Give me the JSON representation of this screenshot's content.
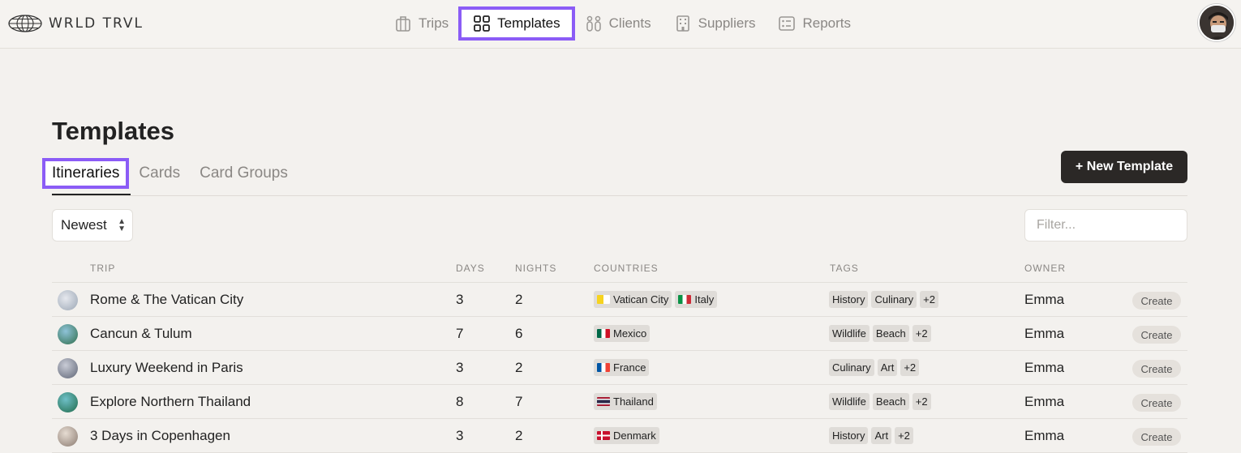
{
  "app": {
    "brand": "WRLD TRVL"
  },
  "nav": {
    "items": [
      {
        "label": "Trips",
        "icon": "suitcase-icon"
      },
      {
        "label": "Templates",
        "icon": "grid-icon",
        "active": true
      },
      {
        "label": "Clients",
        "icon": "people-icon"
      },
      {
        "label": "Suppliers",
        "icon": "building-icon"
      },
      {
        "label": "Reports",
        "icon": "report-icon"
      }
    ]
  },
  "page": {
    "title": "Templates",
    "tabs": [
      {
        "label": "Itineraries",
        "active": true
      },
      {
        "label": "Cards"
      },
      {
        "label": "Card Groups"
      }
    ],
    "new_button": "+ New Template",
    "sort": "Newest",
    "filter_placeholder": "Filter..."
  },
  "table": {
    "headers": {
      "trip": "TRIP",
      "days": "DAYS",
      "nights": "NIGHTS",
      "countries": "COUNTRIES",
      "tags": "TAGS",
      "owner": "OWNER"
    },
    "create_label": "Create",
    "rows": [
      {
        "trip": "Rome & The Vatican City",
        "days": "3",
        "nights": "2",
        "countries": [
          {
            "name": "Vatican City",
            "flag": "vatican"
          },
          {
            "name": "Italy",
            "flag": "italy"
          }
        ],
        "tags": [
          "History",
          "Culinary",
          "+2"
        ],
        "owner": "Emma",
        "thumb_color": "#b8c4d0"
      },
      {
        "trip": "Cancun & Tulum",
        "days": "7",
        "nights": "6",
        "countries": [
          {
            "name": "Mexico",
            "flag": "mexico"
          }
        ],
        "tags": [
          "Wildlife",
          "Beach",
          "+2"
        ],
        "owner": "Emma",
        "thumb_color": "#3f7a5a"
      },
      {
        "trip": "Luxury Weekend in Paris",
        "days": "3",
        "nights": "2",
        "countries": [
          {
            "name": "France",
            "flag": "france"
          }
        ],
        "tags": [
          "Culinary",
          "Art",
          "+2"
        ],
        "owner": "Emma",
        "thumb_color": "#8e96a8"
      },
      {
        "trip": "Explore Northern Thailand",
        "days": "8",
        "nights": "7",
        "countries": [
          {
            "name": "Thailand",
            "flag": "thailand"
          }
        ],
        "tags": [
          "Wildlife",
          "Beach",
          "+2"
        ],
        "owner": "Emma",
        "thumb_color": "#2e8a9a"
      },
      {
        "trip": "3 Days in Copenhagen",
        "days": "3",
        "nights": "2",
        "countries": [
          {
            "name": "Denmark",
            "flag": "denmark"
          }
        ],
        "tags": [
          "History",
          "Art",
          "+2"
        ],
        "owner": "Emma",
        "thumb_color": "#a89c94"
      }
    ]
  },
  "colors": {
    "accent": "#8b5cf6",
    "primary_button": "#2b2826",
    "background": "#f3f1ee"
  }
}
